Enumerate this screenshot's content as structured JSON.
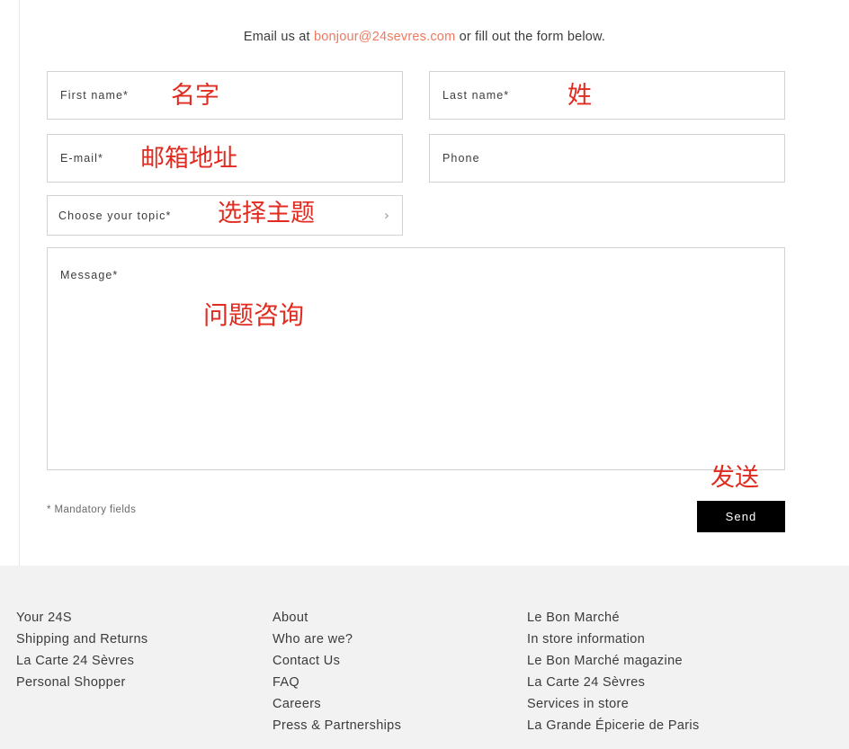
{
  "intro": {
    "before": "Email us at ",
    "email": "bonjour@24sevres.com",
    "after": " or fill out the form below."
  },
  "form": {
    "fields": [
      {
        "label": "First name",
        "required_mark": "*",
        "annotation": "名字"
      },
      {
        "label": "Last name",
        "required_mark": "*",
        "annotation": "姓"
      },
      {
        "label": "E-mail",
        "required_mark": "*",
        "annotation": "邮箱地址"
      },
      {
        "label": "Phone",
        "required_mark": "",
        "annotation": ""
      },
      {
        "label": "Choose your topic",
        "required_mark": "*",
        "annotation": "选择主题",
        "chevron": "›"
      },
      {
        "label": "Message",
        "required_mark": "*",
        "annotation": "问题咨询"
      }
    ],
    "mandatory_note": "* Mandatory fields",
    "send_label": "Send",
    "send_annotation": "发送"
  },
  "footer": {
    "columns": [
      {
        "links": [
          "Your 24S",
          "Shipping and Returns",
          "La Carte 24 Sèvres",
          "Personal Shopper"
        ]
      },
      {
        "links": [
          "About",
          "Who are we?",
          "Contact Us",
          "FAQ",
          "Careers",
          "Press & Partnerships"
        ]
      },
      {
        "links": [
          "Le Bon Marché",
          "In store information",
          "Le Bon Marché magazine",
          "La Carte 24 Sèvres",
          "Services in store",
          "La Grande Épicerie de Paris"
        ]
      }
    ]
  },
  "colors": {
    "accent_link": "#f07a5f",
    "annotation_red": "#e02b20",
    "footer_bg": "#f2f2f2",
    "button_bg": "#000000",
    "field_border": "#d2d2d2"
  }
}
